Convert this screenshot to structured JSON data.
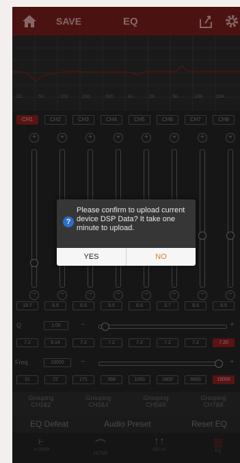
{
  "topbar": {
    "save_label": "SAVE",
    "title": "EQ"
  },
  "graph": {
    "freq_labels": [
      "20",
      "50",
      "100",
      "200",
      "500",
      "1K",
      "2K",
      "5K",
      "10K",
      "20K"
    ]
  },
  "channels": [
    {
      "label": "CH1",
      "active": true
    },
    {
      "label": "CH2",
      "active": false
    },
    {
      "label": "CH3",
      "active": false
    },
    {
      "label": "CH4",
      "active": false
    },
    {
      "label": "CH5",
      "active": false
    },
    {
      "label": "CH6",
      "active": false
    },
    {
      "label": "CH7",
      "active": false
    },
    {
      "label": "CH8",
      "active": false
    }
  ],
  "eq_gain_values": [
    {
      "label": "19.7",
      "active": false
    },
    {
      "label": "8.5",
      "active": false
    },
    {
      "label": "8.5",
      "active": false
    },
    {
      "label": "9.5",
      "active": false
    },
    {
      "label": "8.5",
      "active": false
    },
    {
      "label": "3.7",
      "active": false
    },
    {
      "label": "8.5",
      "active": false
    },
    {
      "label": "9.5",
      "active": false
    }
  ],
  "q_row": {
    "label": "Q",
    "value": "1.00"
  },
  "q_values": [
    {
      "label": "7.2",
      "active": false
    },
    {
      "label": "6.14",
      "active": false
    },
    {
      "label": "7.2",
      "active": false
    },
    {
      "label": "7.2",
      "active": false
    },
    {
      "label": "7.2",
      "active": false
    },
    {
      "label": "7.2",
      "active": false
    },
    {
      "label": "7.2",
      "active": false
    },
    {
      "label": "7.20",
      "active": true
    }
  ],
  "freq_row": {
    "label": "Freq",
    "value": "15000"
  },
  "freq_values": [
    {
      "label": "31",
      "active": false
    },
    {
      "label": "72",
      "active": false
    },
    {
      "label": "171",
      "active": false
    },
    {
      "label": "398",
      "active": false
    },
    {
      "label": "1000",
      "active": false
    },
    {
      "label": "2800",
      "active": false
    },
    {
      "label": "6600",
      "active": false
    },
    {
      "label": "15000",
      "active": true
    }
  ],
  "groups": [
    {
      "line1": "Grouping",
      "line2": "CH1&2"
    },
    {
      "line1": "Grouping",
      "line2": "CH3&4"
    },
    {
      "line1": "Grouping",
      "line2": "CH5&6"
    },
    {
      "line1": "Grouping",
      "line2": "CH7&8"
    }
  ],
  "actions": {
    "eq_defeat": "EQ Defeat",
    "audio_preset": "Audio Preset",
    "reset_eq": "Reset EQ"
  },
  "bottom_nav": [
    {
      "icon": "crossover-icon",
      "label": "X-OVER"
    },
    {
      "icon": "filter-icon",
      "label": "FILTER"
    },
    {
      "icon": "delay-arrows-icon",
      "label": "DELAY"
    },
    {
      "icon": "eq-bars-icon",
      "label": "EQ"
    }
  ],
  "dialog": {
    "message": "Please confirm to upload current device DSP Data? It take one minute to upload.",
    "yes_label": "YES",
    "no_label": "NO"
  },
  "colors": {
    "accent_red": "#8f2020",
    "dialog_no": "#e07b1b",
    "question_icon": "#2a6fc9"
  }
}
